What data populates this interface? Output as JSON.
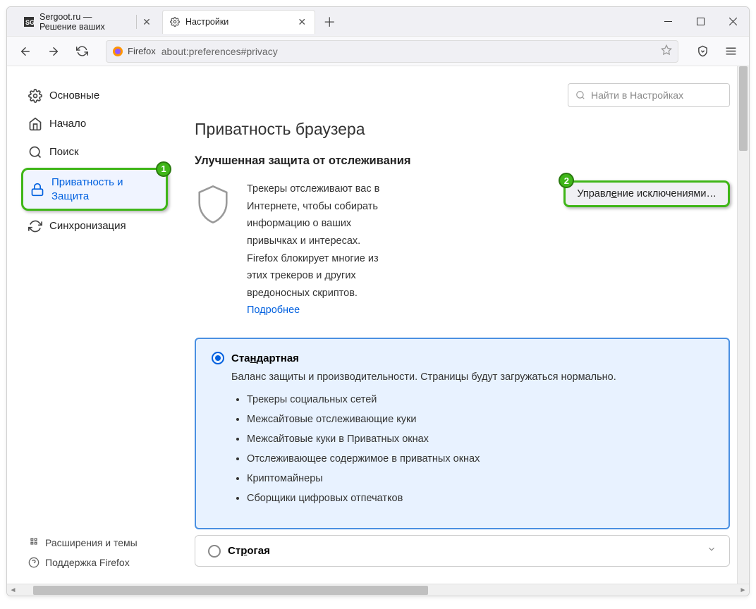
{
  "tabs": {
    "inactive": "Sergoot.ru — Решение ваших",
    "active": "Настройки"
  },
  "url": {
    "prefix": "Firefox",
    "address": "about:preferences#privacy"
  },
  "search": {
    "placeholder": "Найти в Настройках"
  },
  "sidebar": {
    "items": [
      {
        "label": "Основные"
      },
      {
        "label": "Начало"
      },
      {
        "label": "Поиск"
      },
      {
        "label": "Приватность и Защита"
      },
      {
        "label": "Синхронизация"
      }
    ],
    "bottom": [
      {
        "label": "Расширения и темы"
      },
      {
        "label": "Поддержка Firefox"
      }
    ]
  },
  "badges": {
    "one": "1",
    "two": "2"
  },
  "page": {
    "title": "Приватность браузера",
    "section_title": "Улучшенная защита от отслеживания",
    "tracking_text": "Трекеры отслеживают вас в Интернете, чтобы собирать информацию о ваших привычках и интересах. Firefox блокирует многие из этих трекеров и других вредоносных скриптов.",
    "learn_more": "Подробнее",
    "exceptions_button": "Управление исключениями…",
    "standard": {
      "title": "Стандартная",
      "desc": "Баланс защиты и производительности. Страницы будут загружаться нормально.",
      "items": [
        "Трекеры социальных сетей",
        "Межсайтовые отслеживающие куки",
        "Межсайтовые куки в Приватных окнах",
        "Отслеживающее содержимое в приватных окнах",
        "Криптомайнеры",
        "Сборщики цифровых отпечатков"
      ]
    },
    "strict": {
      "title": "Строгая"
    }
  }
}
